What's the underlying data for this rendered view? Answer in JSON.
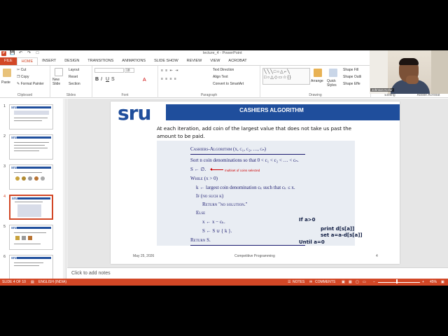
{
  "window": {
    "title": "lecture_4 - PowerPoint"
  },
  "ribbon_tabs": [
    "FILE",
    "HOME",
    "INSERT",
    "DESIGN",
    "TRANSITIONS",
    "ANIMATIONS",
    "SLIDE SHOW",
    "REVIEW",
    "VIEW",
    "ACROBAT"
  ],
  "ribbon": {
    "clipboard": {
      "paste": "Paste",
      "cut": "Cut",
      "copy": "Copy",
      "format_painter": "Format Painter",
      "label": "Clipboard"
    },
    "slides": {
      "new_slide": "New Slide",
      "layout": "Layout",
      "reset": "Reset",
      "section": "Section",
      "label": "Slides"
    },
    "font": {
      "size": "18",
      "label": "Font"
    },
    "paragraph": {
      "text_direction": "Text Direction",
      "align_text": "Align Text",
      "smartart": "Convert to SmartArt",
      "label": "Paragraph"
    },
    "drawing": {
      "arrange": "Arrange",
      "quick_styles": "Quick Styles",
      "shape_fill": "Shape Fill",
      "shape_outline": "Shape Outli",
      "shape_effects": "Shape Effe",
      "label": "Drawing"
    },
    "editing": {
      "label": "Editing"
    },
    "adobe": {
      "label": "Adobe Acrobat"
    }
  },
  "thumbnails": [
    {
      "number": "1"
    },
    {
      "number": "2"
    },
    {
      "number": "3"
    },
    {
      "number": "4"
    },
    {
      "number": "5"
    },
    {
      "number": "6"
    }
  ],
  "slide": {
    "logo": "sru",
    "title": "CASHIERS ALGORITHM",
    "intro": "At each iteration, add coin of the largest value that does not take us past the amount to be paid.",
    "algorithm": {
      "header": "Cashiers-Algorithm (x, c₁, c₂, …, cₙ)",
      "sort": "Sort n coin denominations so that 0 < c₁ < c₂ < … < cₙ.",
      "init": "S ← ∅.",
      "while": "While (x > 0)",
      "k_assign": "k ← largest coin denomination cₖ such that cₖ ≤ x.",
      "if": "If (no such k)",
      "return_none": "Return \"no solution.\"",
      "else": "Else",
      "x_update": "x ← x − cₖ.",
      "s_update": "S ← S ∪ { k }.",
      "return_s": "Return S."
    },
    "annotation": "multiset of coins selected",
    "handwritten": {
      "if": "If a>0",
      "print": "print d[s[a]]",
      "set": "set a=a-d[s[a]]",
      "until": "Until a=0"
    },
    "footer": {
      "date": "May 25, 2026",
      "center": "Competitive Programming",
      "page": "4"
    }
  },
  "notes": {
    "placeholder": "Click to add notes"
  },
  "status": {
    "slide": "SLIDE 4 OF 10",
    "language": "ENGLISH (INDIA)",
    "notes": "NOTES",
    "comments": "COMMENTS",
    "zoom": "45%"
  },
  "webcam": {
    "caption": "Johnson Kollur"
  },
  "colors": {
    "accent": "#d24726",
    "slide_blue": "#1f4e9c",
    "algo_bg": "#e9edf3"
  }
}
